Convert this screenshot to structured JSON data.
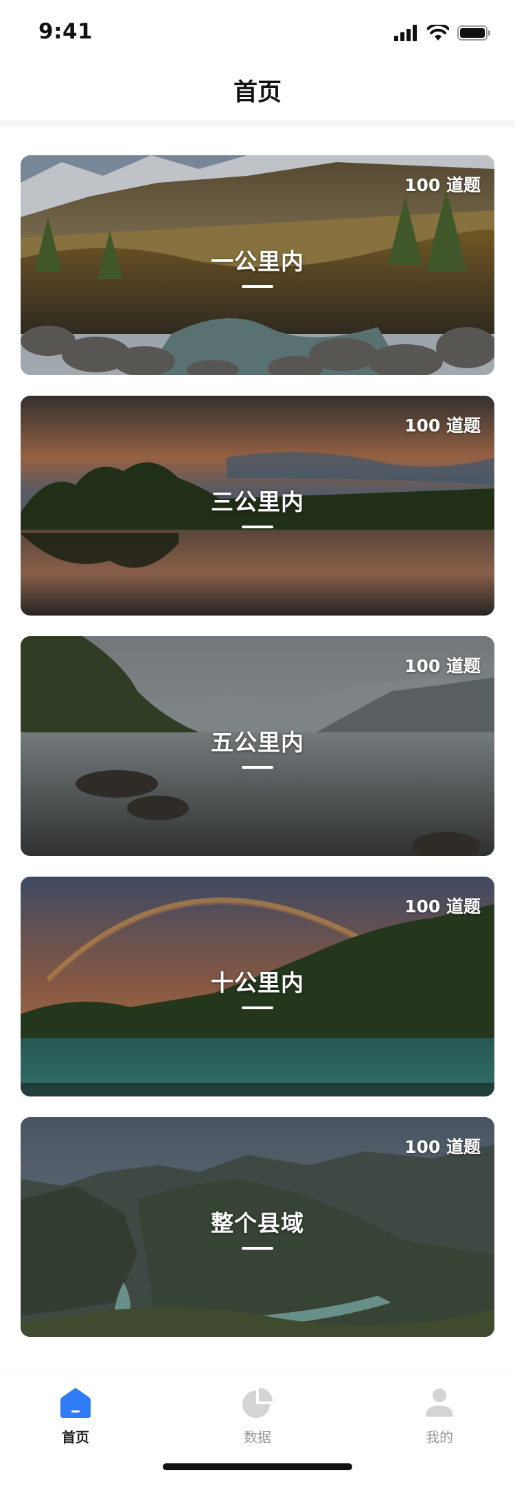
{
  "status_bar": {
    "time": "9:41",
    "icons": [
      "signal-icon",
      "wifi-icon",
      "battery-icon"
    ]
  },
  "header": {
    "title": "首页"
  },
  "cards": [
    {
      "title": "一公里内",
      "count": "100 道题",
      "scene": "mountain-river-photo"
    },
    {
      "title": "三公里内",
      "count": "100 道题",
      "scene": "sunset-lake-photo"
    },
    {
      "title": "五公里内",
      "count": "100 道题",
      "scene": "misty-lake-photo"
    },
    {
      "title": "十公里内",
      "count": "100 道题",
      "scene": "rainbow-lake-photo"
    },
    {
      "title": "整个县域",
      "count": "100 道题",
      "scene": "valley-river-photo"
    }
  ],
  "tab_bar": {
    "items": [
      {
        "label": "首页",
        "icon": "home-icon",
        "active": true
      },
      {
        "label": "数据",
        "icon": "pie-chart-icon",
        "active": false
      },
      {
        "label": "我的",
        "icon": "user-icon",
        "active": false
      }
    ]
  },
  "colors": {
    "accent": "#2f7cf6",
    "tab_inactive": "#d4d4d4",
    "text_primary": "#222222"
  }
}
